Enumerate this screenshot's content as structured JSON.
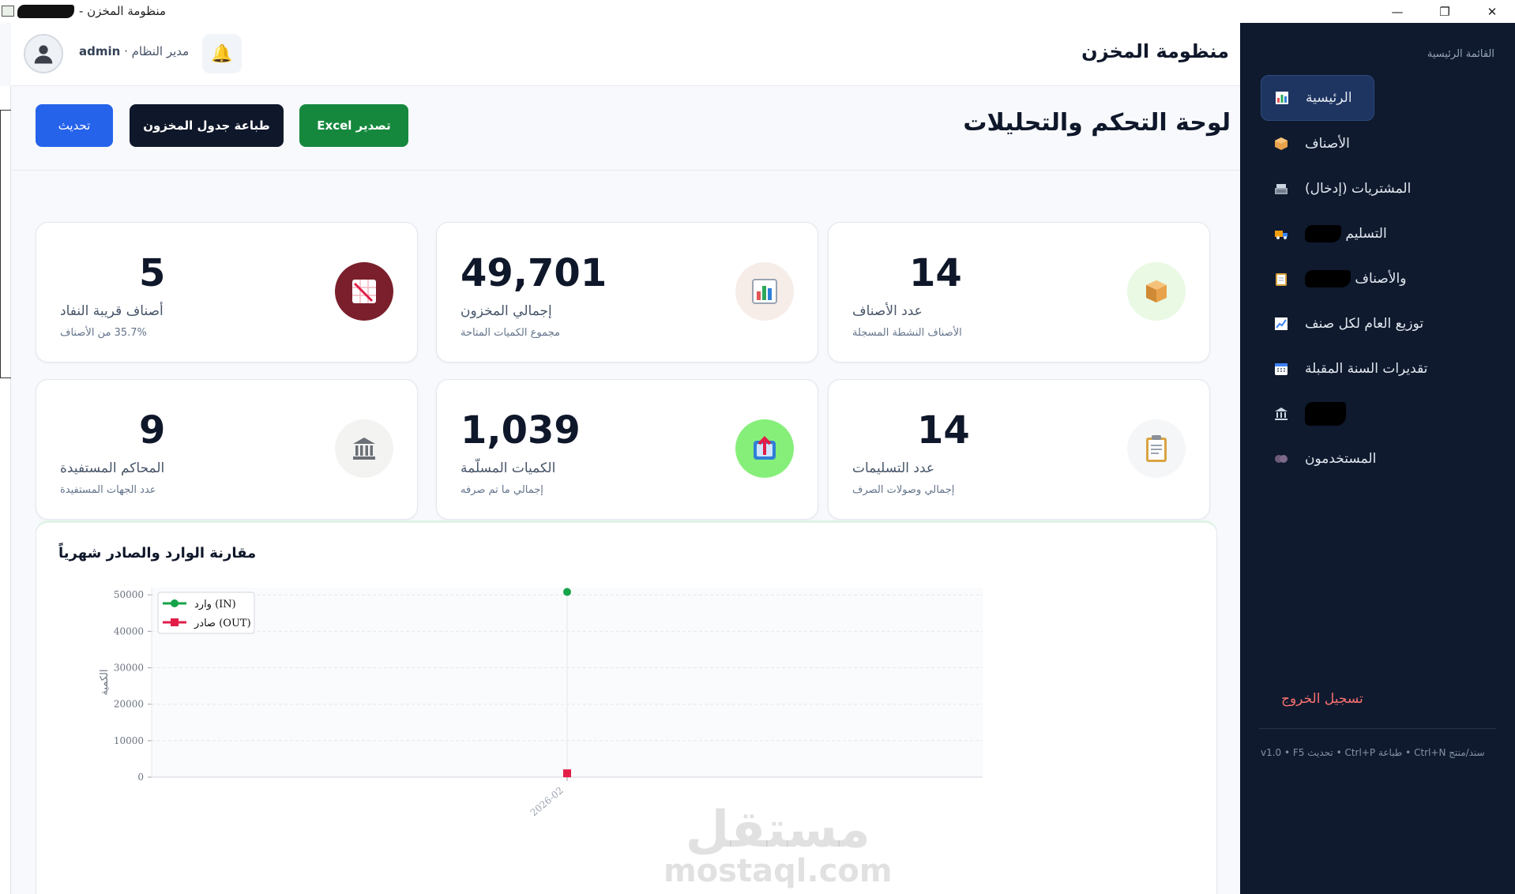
{
  "window": {
    "title": "منظومة المخزن -"
  },
  "header": {
    "brand": "منظومة المخزن",
    "user_name": "admin",
    "user_role": "مدير النظام"
  },
  "page": {
    "title": "لوحة التحكم والتحليلات",
    "buttons": {
      "refresh": "تحديث",
      "print": "طباعة جدول المخزون",
      "excel": "تصدير Excel"
    }
  },
  "cards": [
    {
      "value": "14",
      "label": "عدد الأصناف",
      "sub": "الأصناف النشطة المسجلة",
      "icon": "box-icon",
      "icon_bg": "#e9f9e4"
    },
    {
      "value": "49,701",
      "label": "إجمالي المخزون",
      "sub": "مجموع الكميات المتاحة",
      "icon": "bar-chart-icon",
      "icon_bg": "#f6ece8"
    },
    {
      "value": "5",
      "label": "أصناف قريبة النفاد",
      "sub": "35.7% من الأصناف",
      "icon": "trend-down-icon",
      "icon_bg": "#7a1f2b"
    },
    {
      "value": "14",
      "label": "عدد التسليمات",
      "sub": "إجمالي وصولات الصرف",
      "icon": "clipboard-icon",
      "icon_bg": "#f4f6f8"
    },
    {
      "value": "1,039",
      "label": "الكميات المسلّمة",
      "sub": "إجمالي ما تم صرفه",
      "icon": "outbox-icon",
      "icon_bg": "#86ef7a"
    },
    {
      "value": "9",
      "label": "المحاكم المستفيدة",
      "sub": "عدد الجهات المستفيدة",
      "icon": "bank-icon",
      "icon_bg": "#f3f4f2"
    }
  ],
  "chart": {
    "card_title": "مقارنة الوارد والصادر شهرياً"
  },
  "chart_data": {
    "type": "line",
    "title": "مقارنة الوارد والصادر شهرياً",
    "x": [
      "2026-02"
    ],
    "series": [
      {
        "name": "وارد (IN)",
        "values": [
          50800
        ],
        "color": "#16a34a",
        "marker": "circle"
      },
      {
        "name": "صادر (OUT)",
        "values": [
          1039
        ],
        "color": "#e11d48",
        "marker": "square"
      }
    ],
    "xlabel": "",
    "ylabel": "الكمية",
    "ylim": [
      0,
      52000
    ],
    "yticks": [
      0,
      10000,
      20000,
      30000,
      40000,
      50000
    ],
    "legend": "top-left",
    "grid": true
  },
  "sidebar": {
    "heading": "القائمة الرئيسية",
    "items": [
      {
        "label": "الرئيسية",
        "icon": "dashboard-icon",
        "active": true
      },
      {
        "label": "الأصناف",
        "icon": "box-icon"
      },
      {
        "label": "المشتريات (إدخال)",
        "icon": "cash-register-icon"
      },
      {
        "label": "التسليم",
        "icon": "truck-icon"
      },
      {
        "label": "والأصناف",
        "icon": "clipboard-icon"
      },
      {
        "label": "توزيع العام لكل صنف",
        "icon": "chart-icon"
      },
      {
        "label": "تقديرات السنة المقبلة",
        "icon": "calendar-icon"
      },
      {
        "label": "",
        "icon": "bank-icon"
      },
      {
        "label": "المستخدمون",
        "icon": "users-icon"
      }
    ],
    "logout": "تسجيل الخروج",
    "shortcuts": "v1.0  •  F5 تحديث  •  Ctrl+P طباعة  •  Ctrl+N سند/منتج"
  },
  "watermark": {
    "line1": "مستقل",
    "line2": "mostaql.com"
  }
}
